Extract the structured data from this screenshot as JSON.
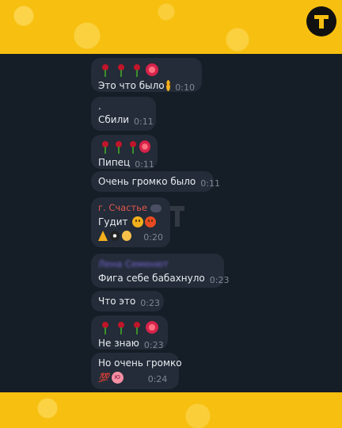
{
  "brand": {
    "logo_icon": "t-logo-icon"
  },
  "messages": [
    {
      "emoji": [
        "rose",
        "rose",
        "rose",
        "flower"
      ],
      "text": "Это что было",
      "trailing_emoji": "flushed-face",
      "time": "0:10"
    },
    {
      "text": ".",
      "text2": "Сбили",
      "time": "0:11"
    },
    {
      "emoji": [
        "rose",
        "rose",
        "rose",
        "flower"
      ],
      "text": "Пипец",
      "time": "0:11"
    },
    {
      "text": "Очень громко было",
      "time": "0:11"
    },
    {
      "sender": "г. Счастье",
      "sender_icon": "mask-emoji",
      "text": "Гудит",
      "trailing_emoji": [
        "pouting-face",
        "angry-face"
      ],
      "reactions": [
        "pray",
        "swirl",
        "moon"
      ],
      "time": "0:20"
    },
    {
      "sender": "Лена Семенют",
      "text": "Фига себе бабахнуло",
      "time": "0:23"
    },
    {
      "text": "Что это",
      "time": "0:23"
    },
    {
      "emoji": [
        "rose",
        "rose",
        "rose",
        "flower"
      ],
      "text": "Не знаю",
      "time": "0:23"
    },
    {
      "text": "Но очень громко",
      "reactions": [
        "hundred",
        "nerd"
      ],
      "time": "0:24"
    }
  ],
  "colors": {
    "brand_yellow": "#f7bf10",
    "chat_bg": "#151d26",
    "bubble_bg": "#232c38",
    "sender_red": "#e2564f",
    "sender_purple": "#7a67d6"
  }
}
